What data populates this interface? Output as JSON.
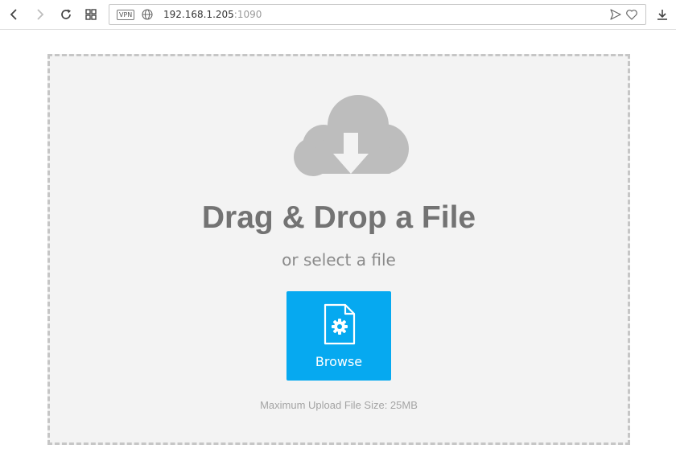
{
  "browser": {
    "vpn_label": "VPN",
    "url_host": "192.168.1.205",
    "url_port": ":1090",
    "icons": [
      "back-icon",
      "forward-icon",
      "reload-icon",
      "tabs-grid-icon",
      "globe-icon",
      "send-icon",
      "heart-icon",
      "download-icon"
    ]
  },
  "upload": {
    "title": "Drag & Drop a File",
    "subtitle": "or select a file",
    "browse_label": "Browse",
    "max_size": "Maximum Upload File Size: 25MB",
    "icons": [
      "cloud-download-icon",
      "file-settings-icon"
    ]
  },
  "colors": {
    "accent": "#06a9f0",
    "dropzone_bg": "#f3f3f3",
    "dropzone_border": "#c6c6c6",
    "icon_gray": "#bdbdbd",
    "title": "#737373"
  }
}
